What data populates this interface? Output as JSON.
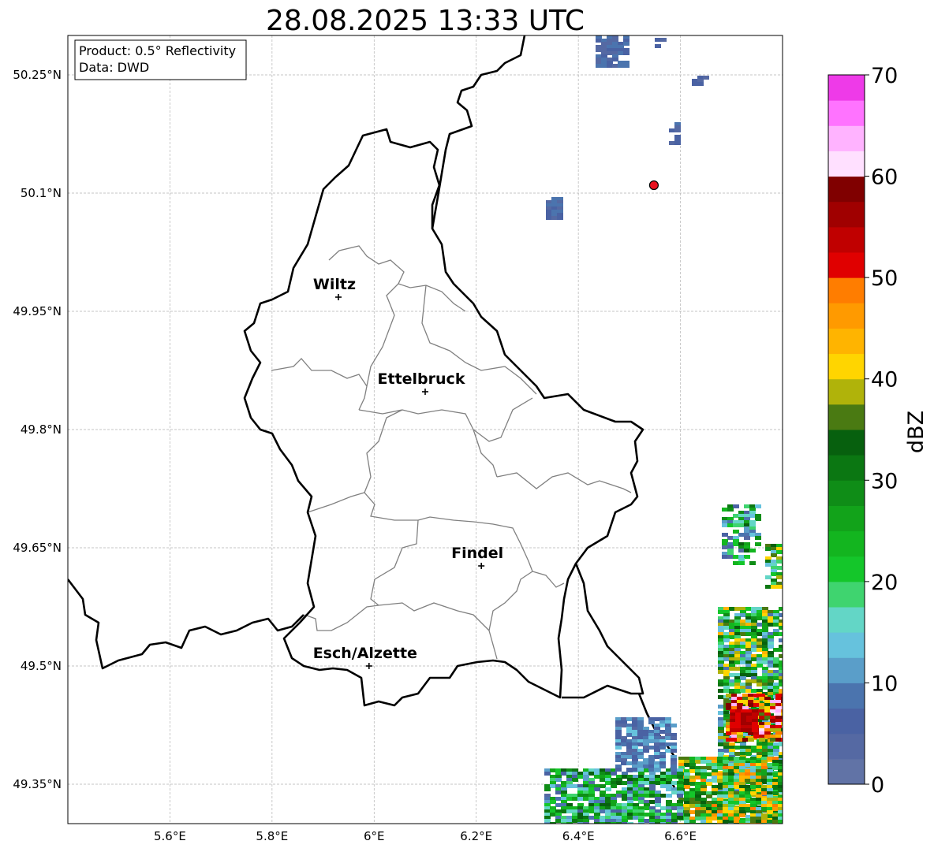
{
  "title": "28.08.2025 13:33 UTC",
  "info": {
    "product": "Product: 0.5° Reflectivity",
    "data": "Data: DWD"
  },
  "longitude_ticks": [
    {
      "value": 5.6,
      "label": "5.6°E"
    },
    {
      "value": 5.8,
      "label": "5.8°E"
    },
    {
      "value": 6.0,
      "label": "6°E"
    },
    {
      "value": 6.2,
      "label": "6.2°E"
    },
    {
      "value": 6.4,
      "label": "6.4°E"
    },
    {
      "value": 6.6,
      "label": "6.6°E"
    }
  ],
  "latitude_ticks": [
    {
      "value": 50.25,
      "label": "50.25°N"
    },
    {
      "value": 50.1,
      "label": "50.1°N"
    },
    {
      "value": 49.95,
      "label": "49.95°N"
    },
    {
      "value": 49.8,
      "label": "49.8°N"
    },
    {
      "value": 49.65,
      "label": "49.65°N"
    },
    {
      "value": 49.5,
      "label": "49.5°N"
    },
    {
      "value": 49.35,
      "label": "49.35°N"
    }
  ],
  "extent": {
    "lon_min": 5.4,
    "lon_max": 6.8,
    "lat_min": 49.3,
    "lat_max": 50.3
  },
  "cities": [
    {
      "name": "Wiltz",
      "lon": 5.93,
      "lat": 49.968
    },
    {
      "name": "Ettelbruck",
      "lon": 6.1,
      "lat": 49.848
    },
    {
      "name": "Findel",
      "lon": 6.21,
      "lat": 49.627
    },
    {
      "name": "Esch/Alzette",
      "lon": 5.99,
      "lat": 49.5
    }
  ],
  "radar_site": {
    "lon": 6.548,
    "lat": 50.11,
    "color": "#e8101e"
  },
  "colorbar": {
    "label": "dBZ",
    "min": 0,
    "max": 70,
    "ticks": [
      "0",
      "10",
      "20",
      "30",
      "40",
      "50",
      "60",
      "70"
    ],
    "colors": [
      "#6173a6",
      "#5569a3",
      "#4a62a3",
      "#4b74ae",
      "#5a9ec9",
      "#66c2dd",
      "#63d6c6",
      "#3fd46f",
      "#14c62a",
      "#13b51f",
      "#12a31a",
      "#0f8d17",
      "#0b7712",
      "#07600e",
      "#4a7a12",
      "#b0b30a",
      "#ffd500",
      "#ffb400",
      "#ff9a00",
      "#ff7d00",
      "#e00000",
      "#c00000",
      "#a00000",
      "#800000",
      "#ffe0ff",
      "#ffb3ff",
      "#ff73ff",
      "#ee3ae8"
    ]
  },
  "legend_colors": {
    "border_national": "#000000",
    "border_canton": "#808080",
    "grid": "#b3b3b3"
  }
}
